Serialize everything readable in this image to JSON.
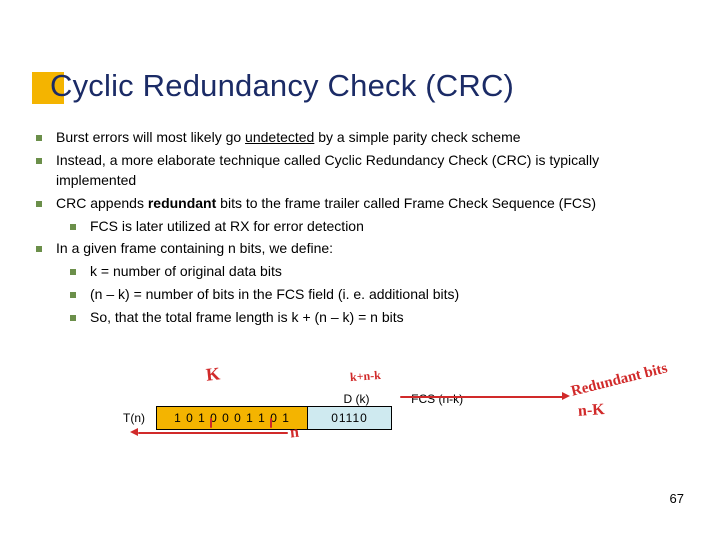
{
  "title": "Cyclic Redundancy Check (CRC)",
  "bullets": {
    "b1a": "Burst errors will most likely go ",
    "b1u": "undetected",
    "b1b": " by a simple parity check scheme",
    "b2": "Instead, a more elaborate technique called Cyclic Redundancy Check (CRC) is typically implemented",
    "b3a": "CRC appends ",
    "b3bold": "redundant",
    "b3b": " bits to the frame trailer called Frame Check Sequence (FCS)",
    "b3s1": "FCS is later utilized at RX for error detection",
    "b4": "In a given frame containing n bits, we define:",
    "b4s1": "k =  number of original data bits",
    "b4s2": "(n – k) = number of bits in the FCS field (i. e. additional bits)",
    "b4s3": "So, that the total frame length is k + (n – k) = n bits"
  },
  "diagram": {
    "dk_label": "D (k)",
    "fcs_label": "FCS (n-k)",
    "tn_label": "T(n)",
    "data_bits": "1 0 1 0 0 0 1 1 0 1",
    "fcs_bits": "01110"
  },
  "handwriting": {
    "k": "K",
    "k_plus": "k+n-k",
    "redundant": "Redundant bits",
    "n_minus_k": "n-K",
    "n": "n"
  },
  "page_number": "67"
}
